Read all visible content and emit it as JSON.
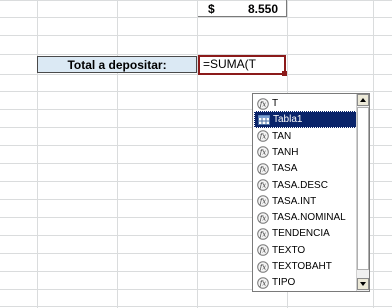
{
  "sheet": {
    "top_value": {
      "currency": "$",
      "amount": "8.550"
    },
    "label": "Total a depositar:",
    "formula": "=SUMA(T"
  },
  "autocomplete": {
    "items": [
      {
        "label": "T",
        "icon": "function-icon"
      },
      {
        "label": "Tabla1",
        "icon": "table-icon",
        "selected": true
      },
      {
        "label": "TAN",
        "icon": "function-icon"
      },
      {
        "label": "TANH",
        "icon": "function-icon"
      },
      {
        "label": "TASA",
        "icon": "function-icon"
      },
      {
        "label": "TASA.DESC",
        "icon": "function-icon"
      },
      {
        "label": "TASA.INT",
        "icon": "function-icon"
      },
      {
        "label": "TASA.NOMINAL",
        "icon": "function-icon"
      },
      {
        "label": "TENDENCIA",
        "icon": "function-icon"
      },
      {
        "label": "TEXTO",
        "icon": "function-icon"
      },
      {
        "label": "TEXTOBAHT",
        "icon": "function-icon"
      },
      {
        "label": "TIPO",
        "icon": "function-icon"
      }
    ]
  },
  "colors": {
    "selection": "#0a246a",
    "label_fill": "#dbe9f4",
    "active_border": "#8b1a1a",
    "gridline": "#dadcdd"
  }
}
